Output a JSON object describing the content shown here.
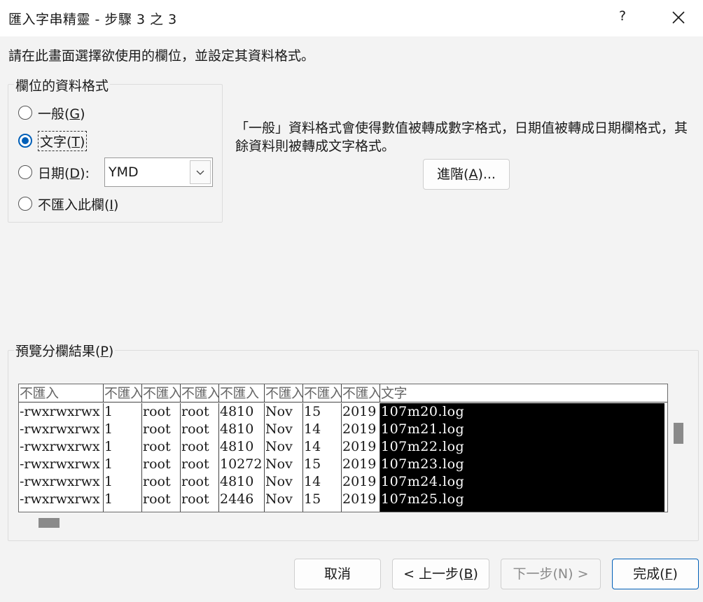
{
  "window": {
    "title": "匯入字串精靈 - 步驟 3 之 3",
    "help_label": "?"
  },
  "instruction": "請在此畫面選擇欲使用的欄位，並設定其資料格式。",
  "column_format": {
    "legend": "欄位的資料格式",
    "options": [
      {
        "label": "一般(",
        "key": "G",
        "suffix": ")",
        "checked": false
      },
      {
        "label": "文字(",
        "key": "T",
        "suffix": ")",
        "checked": true
      },
      {
        "label": "日期(",
        "key": "D",
        "suffix": "):",
        "checked": false
      },
      {
        "label": "不匯入此欄(",
        "key": "I",
        "suffix": ")",
        "checked": false
      }
    ],
    "date_format_value": "YMD"
  },
  "description": "「一般」資料格式會使得數值被轉成數字格式，日期值被轉成日期欄格式，其餘資料則被轉成文字格式。",
  "advanced_button": {
    "label": "進階(",
    "key": "A",
    "suffix": ")..."
  },
  "preview": {
    "legend_prefix": "預覽分欄結果(",
    "legend_key": "P",
    "legend_suffix": ")",
    "headers": [
      "不匯入",
      "不匯入",
      "不匯入",
      "不匯入",
      "不匯入",
      "不匯入",
      "不匯入",
      "不匯入",
      "文字"
    ],
    "columns": [
      [
        "-rwxrwxrwx",
        "-rwxrwxrwx",
        "-rwxrwxrwx",
        "-rwxrwxrwx",
        "-rwxrwxrwx",
        "-rwxrwxrwx"
      ],
      [
        "1",
        "1",
        "1",
        "1",
        "1",
        "1"
      ],
      [
        "root",
        "root",
        "root",
        "root",
        "root",
        "root"
      ],
      [
        "root",
        "root",
        "root",
        "root",
        "root",
        "root"
      ],
      [
        "4810",
        "4810",
        "4810",
        "10272",
        "4810",
        "2446"
      ],
      [
        "Nov",
        "Nov",
        "Nov",
        "Nov",
        "Nov",
        "Nov"
      ],
      [
        "15",
        "14",
        "14",
        "15",
        "14",
        "15"
      ],
      [
        "2019",
        "2019",
        "2019",
        "2019",
        "2019",
        "2019"
      ],
      [
        "107m20.log",
        "107m21.log",
        "107m22.log",
        "107m23.log",
        "107m24.log",
        "107m25.log"
      ]
    ]
  },
  "buttons": {
    "cancel": "取消",
    "back": {
      "label": "< 上一步(",
      "key": "B",
      "suffix": ")"
    },
    "next": "下一步(N) >",
    "finish": {
      "label": "完成(",
      "key": "F",
      "suffix": ")"
    }
  },
  "colors": {
    "accent": "#005fb8",
    "selected_column_bg": "#000000"
  }
}
